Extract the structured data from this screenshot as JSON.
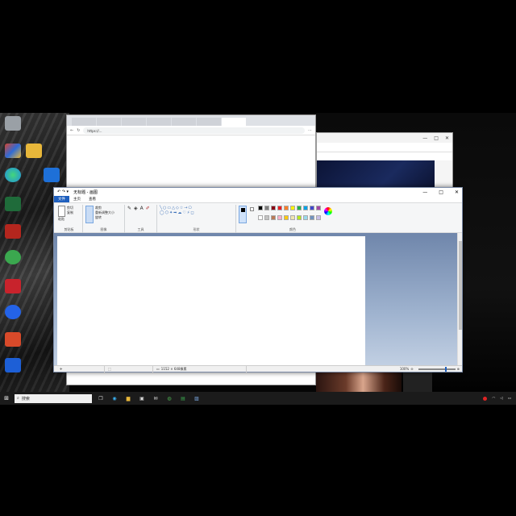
{
  "desktop": {
    "icons": [
      {
        "name": "recycle-bin-icon",
        "label": "",
        "color": "#9aa0a6"
      },
      {
        "name": "app-icon-colorful",
        "label": "",
        "color": "#d6452f"
      },
      {
        "name": "folder-icon",
        "label": "",
        "color": "#e8b73a"
      },
      {
        "name": "edge-icon",
        "label": "",
        "color": "#1f8fe0"
      },
      {
        "name": "app-icon-blue-m",
        "label": "",
        "color": "#1e70d8"
      },
      {
        "name": "terminal-icon",
        "label": "",
        "color": "#1f6b3a"
      },
      {
        "name": "acrobat-icon",
        "label": "",
        "color": "#b3261e"
      },
      {
        "name": "wechat-icon",
        "label": "",
        "color": "#3ba84f"
      },
      {
        "name": "app-icon-red",
        "label": "",
        "color": "#c8232c"
      },
      {
        "name": "app-icon-f",
        "label": "",
        "color": "#2463e8"
      },
      {
        "name": "app-icon-shield",
        "label": "",
        "color": "#d84a2a"
      },
      {
        "name": "app-icon-blue-chat",
        "label": "",
        "color": "#1d5fd6"
      }
    ]
  },
  "browser_back": {
    "tabs": [
      "",
      "",
      "",
      "",
      "",
      "",
      ""
    ],
    "url": "https://...",
    "buttons": {
      "back": "←",
      "reload": "↻",
      "menu": "⋯"
    }
  },
  "browser_right": {
    "controls": {
      "minimize": "—",
      "maximize": "□",
      "close": "✕"
    },
    "url": ""
  },
  "paint": {
    "title": "无标题 - 画图",
    "quick_access": "↶ ↷ ▾",
    "controls": {
      "minimize": "—",
      "maximize": "□",
      "close": "✕"
    },
    "menu": [
      "文件",
      "主页",
      "查看"
    ],
    "groups": [
      "剪贴板",
      "图像",
      "工具",
      "形状",
      "颜色"
    ],
    "clipboard": {
      "paste": "粘贴",
      "cut": "剪切",
      "copy": "复制"
    },
    "image": {
      "select": "选择",
      "crop": "裁剪",
      "resize": "重新调整大小",
      "rotate": "旋转"
    },
    "colors": {
      "color1_label": "颜色1",
      "color2_label": "颜色2",
      "edit_label": "编辑颜色",
      "paint3d_label": "使用画图3D进行编辑",
      "palette": [
        "#000000",
        "#7f7f7f",
        "#880015",
        "#ed1c24",
        "#ff7f27",
        "#fff200",
        "#22b14c",
        "#00a2e8",
        "#3f48cc",
        "#a349a4",
        "#ffffff",
        "#c3c3c3",
        "#b97a57",
        "#ffaec9",
        "#ffc90e",
        "#efe4b0",
        "#b5e61d",
        "#99d9ea",
        "#7092be",
        "#c8bfe7"
      ]
    },
    "status": {
      "position": "",
      "size": "1152 × 648像素",
      "zoom": "100%"
    }
  },
  "taskbar": {
    "start": "⊞",
    "search_placeholder": "搜索",
    "tray_text": "",
    "time": ""
  }
}
